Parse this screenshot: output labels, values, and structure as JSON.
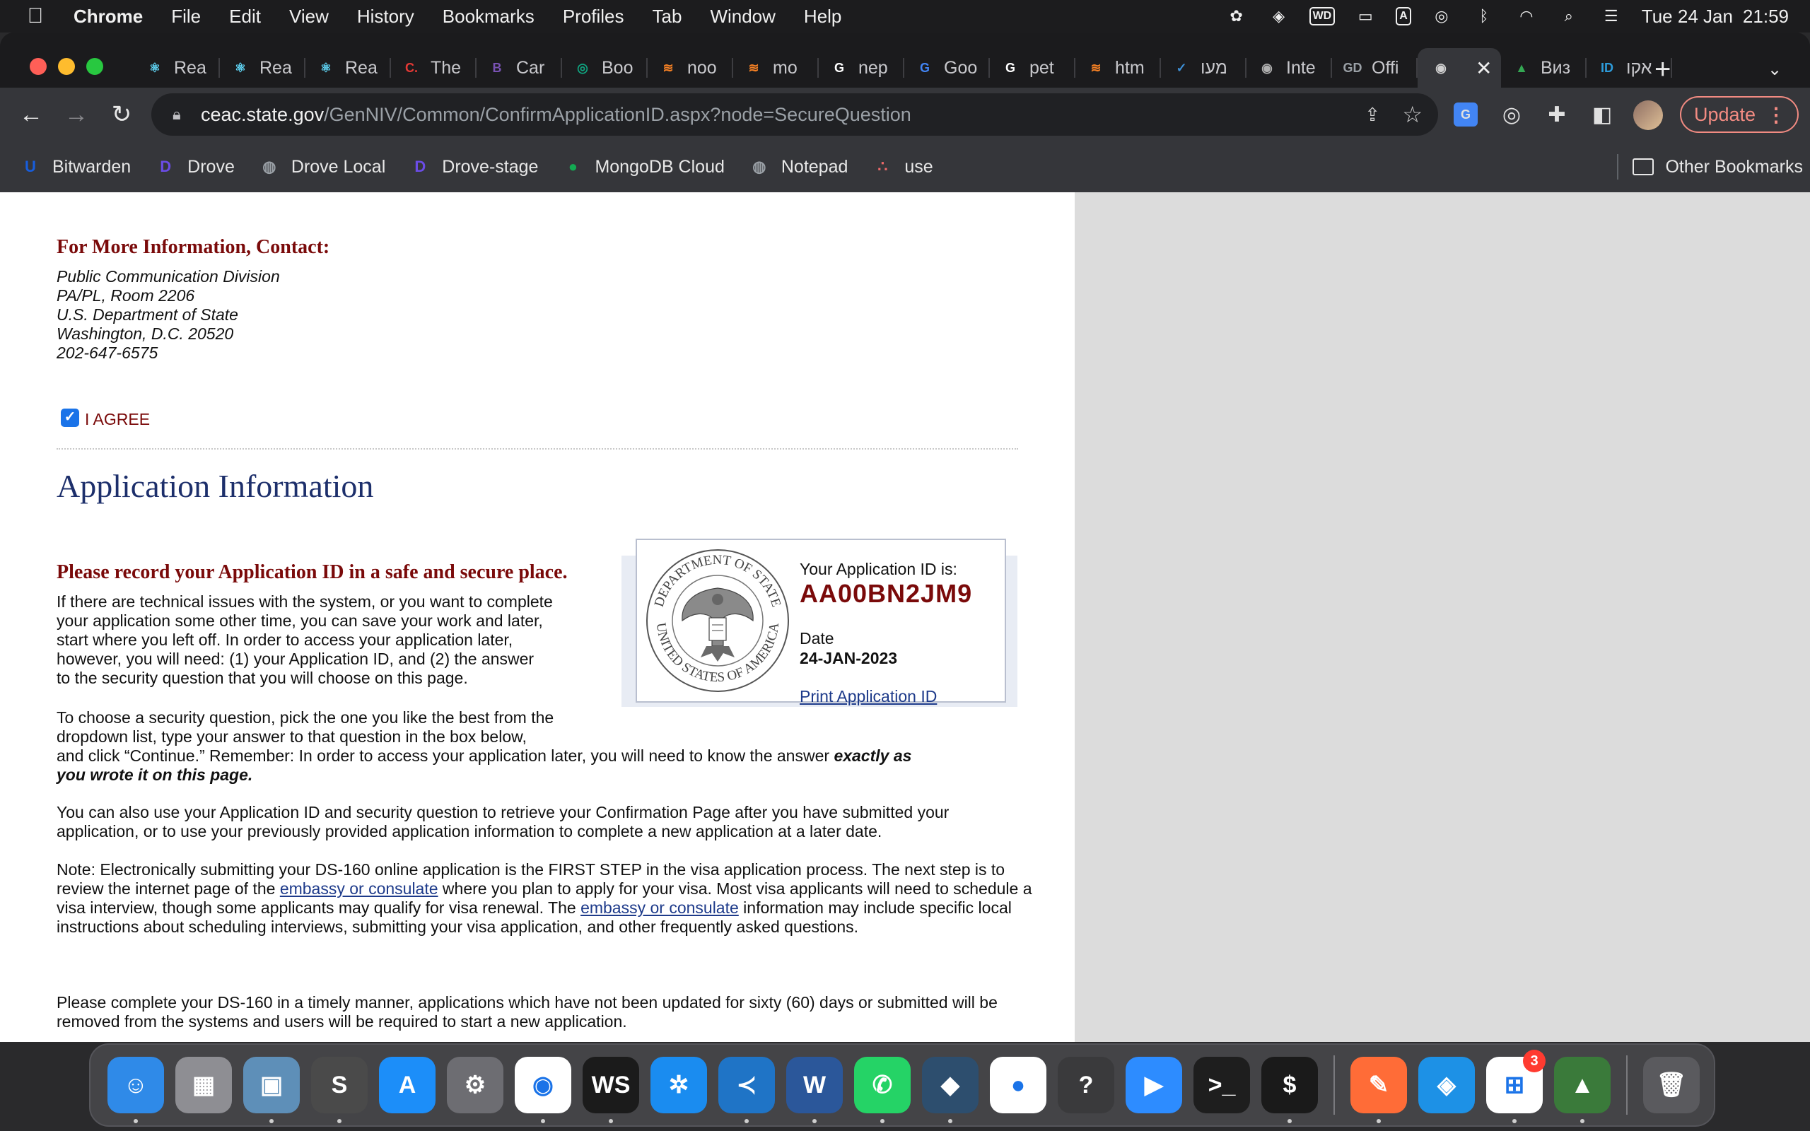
{
  "menubar": {
    "app_name": "Chrome",
    "items": [
      "File",
      "Edit",
      "View",
      "History",
      "Bookmarks",
      "Profiles",
      "Tab",
      "Window",
      "Help"
    ],
    "clock": {
      "date": "Tue 24 Jan",
      "time": "21:59"
    },
    "status_box_a": "A",
    "status_box_wd": "WD"
  },
  "tabs": [
    {
      "label": "Rea",
      "icon": "react-icon",
      "color": "#61dafb",
      "glyph": "⚛"
    },
    {
      "label": "Rea",
      "icon": "react-icon",
      "color": "#61dafb",
      "glyph": "⚛"
    },
    {
      "label": "Rea",
      "icon": "react-icon",
      "color": "#61dafb",
      "glyph": "⚛"
    },
    {
      "label": "The",
      "icon": "c-icon",
      "color": "#e53935",
      "glyph": "C."
    },
    {
      "label": "Car",
      "icon": "bootstrap-icon",
      "color": "#7952b3",
      "glyph": "B"
    },
    {
      "label": "Boo",
      "icon": "openai-icon",
      "color": "#10a37f",
      "glyph": "◎"
    },
    {
      "label": "noo",
      "icon": "stackoverflow-icon",
      "color": "#f48024",
      "glyph": "≋"
    },
    {
      "label": "mo",
      "icon": "stackoverflow-icon",
      "color": "#f48024",
      "glyph": "≋"
    },
    {
      "label": "nep",
      "icon": "google-icon",
      "color": "#ffffff",
      "glyph": "G"
    },
    {
      "label": "Goo",
      "icon": "google-translate-icon",
      "color": "#4285f4",
      "glyph": "G"
    },
    {
      "label": "pet",
      "icon": "google-icon",
      "color": "#ffffff",
      "glyph": "G"
    },
    {
      "label": "htm",
      "icon": "stackoverflow-icon",
      "color": "#f48024",
      "glyph": "≋"
    },
    {
      "label": "מעו",
      "icon": "check-icon",
      "color": "#3d8fd6",
      "glyph": "✓"
    },
    {
      "label": "Inte",
      "icon": "seal-icon",
      "color": "#b0b0b0",
      "glyph": "◉"
    },
    {
      "label": "Offi",
      "icon": "gd-icon",
      "color": "#9aa0a6",
      "glyph": "GD"
    },
    {
      "label": "",
      "icon": "seal-icon",
      "color": "#d0d0d0",
      "glyph": "◉",
      "active": true
    },
    {
      "label": "Виз",
      "icon": "google-drive-icon",
      "color": "#34a853",
      "glyph": "▲"
    },
    {
      "label": "אקו",
      "icon": "id-icon",
      "color": "#2d9cdb",
      "glyph": "ID"
    }
  ],
  "toolbar": {
    "url_domain": "ceac.state.gov",
    "url_path": "/GenNIV/Common/ConfirmApplicationID.aspx?node=SecureQuestion",
    "update_label": "Update"
  },
  "bookmarks": [
    {
      "label": "Bitwarden",
      "icon": "bitwarden-icon",
      "color": "#175ddc",
      "glyph": "U"
    },
    {
      "label": "Drove",
      "icon": "drove-icon",
      "color": "#6b4ce6",
      "glyph": "D"
    },
    {
      "label": "Drove Local",
      "icon": "globe-icon",
      "color": "#9aa0a6",
      "glyph": "◍"
    },
    {
      "label": "Drove-stage",
      "icon": "drove-icon",
      "color": "#6b4ce6",
      "glyph": "D"
    },
    {
      "label": "MongoDB Cloud",
      "icon": "mongodb-icon",
      "color": "#13aa52",
      "glyph": "●"
    },
    {
      "label": "Notepad",
      "icon": "globe-icon",
      "color": "#9aa0a6",
      "glyph": "◍"
    },
    {
      "label": "use",
      "icon": "asana-icon",
      "color": "#f06a6a",
      "glyph": "∴"
    }
  ],
  "other_bookmarks_label": "Other Bookmarks",
  "page": {
    "contact_heading": "For More Information, Contact:",
    "contact_lines": [
      "Public Communication Division",
      "PA/PL, Room 2206",
      "U.S. Department of State",
      "Washington, D.C. 20520",
      "202-647-6575"
    ],
    "agree_label": "I AGREE",
    "agree_checked": true,
    "section_title": "Application Information",
    "record_heading": "Please record your Application ID in a safe and secure place.",
    "intro_lines": [
      "If there are technical issues with the system, or you want to complete",
      "your application some other time, you can save your work and later,",
      "start where you left off. In order to access your application later,",
      "however, you will need: (1) your Application ID, and (2) the answer",
      "to the security question that you will choose on this page."
    ],
    "security_line1": "To choose a security question, pick the one you like the best from the",
    "security_line2": "dropdown list, type your answer to that question in the box below,",
    "security_line3": "and click “Continue.” Remember: In order to access your application later, you will need to know the answer ",
    "security_emph1": "exactly as",
    "security_emph2": "you wrote it on this page.",
    "retrieve_para": "You can also use your Application ID and security question to retrieve your Confirmation Page after you have submitted your application, or to use your previously provided application information to complete a new application at a later date.",
    "note_part1": "Note: Electronically submitting your DS-160 online application is the FIRST STEP in the visa application process. The next step is to review the internet page of the ",
    "note_link1": "embassy or consulate",
    "note_part2": " where you plan to apply for your visa. Most visa applicants will need to schedule a visa interview, though some applicants may qualify for visa renewal. The ",
    "note_link2": "embassy or consulate",
    "note_part3": " information may include specific local instructions about scheduling interviews, submitting your visa application, and other frequently asked questions.",
    "timely_para": "Please complete your DS-160 in a timely manner, applications which have not been updated for sixty (60) days or submitted will be removed from the systems and users will be required to start a new application.",
    "appid_label": "Your Application ID is:",
    "appid_value": "AA00BN2JM9",
    "date_label": "Date",
    "date_value": "24-JAN-2023",
    "print_link": "Print Application ID",
    "seal_top_text": "DEPARTMENT OF STATE",
    "seal_bottom_text": "UNITED STATES OF AMERICA"
  },
  "dock": [
    {
      "name": "finder",
      "color": "#2f8ae8",
      "glyph": "☺",
      "running": true
    },
    {
      "name": "launchpad",
      "color": "#8e8e93",
      "glyph": "▦",
      "running": false
    },
    {
      "name": "preview",
      "color": "#5e8fb8",
      "glyph": "▣",
      "running": true
    },
    {
      "name": "sublime-text",
      "color": "#4a4a4a",
      "glyph": "S",
      "running": true
    },
    {
      "name": "app-store",
      "color": "#1c8ef9",
      "glyph": "A",
      "running": false
    },
    {
      "name": "system-preferences",
      "color": "#6d6d72",
      "glyph": "⚙",
      "running": false
    },
    {
      "name": "chrome",
      "color": "#ffffff",
      "glyph": "◉",
      "running": true
    },
    {
      "name": "webstorm",
      "color": "#1b1b1b",
      "glyph": "WS",
      "running": true
    },
    {
      "name": "safari",
      "color": "#1a8cf0",
      "glyph": "✲",
      "running": false
    },
    {
      "name": "vscode",
      "color": "#1f74c6",
      "glyph": "≺",
      "running": true
    },
    {
      "name": "word",
      "color": "#2b579a",
      "glyph": "W",
      "running": true
    },
    {
      "name": "whatsapp",
      "color": "#25d366",
      "glyph": "✆",
      "running": true
    },
    {
      "name": "mysql-workbench",
      "color": "#2d4e6e",
      "glyph": "◆",
      "running": true
    },
    {
      "name": "mongodb-compass",
      "color": "#ffffff",
      "glyph": "●",
      "running": false
    },
    {
      "name": "help",
      "color": "#3a3a3c",
      "glyph": "?",
      "running": false
    },
    {
      "name": "zoom",
      "color": "#2d8cff",
      "glyph": "▶",
      "running": false
    },
    {
      "name": "terminal",
      "color": "#1e1e1e",
      "glyph": ">_",
      "running": false
    },
    {
      "name": "iterm",
      "color": "#1a1a1a",
      "glyph": "$",
      "running": true
    },
    {
      "name": "postman",
      "color": "#ff6c37",
      "glyph": "✎",
      "running": true
    },
    {
      "name": "docker",
      "color": "#1d91e6",
      "glyph": "◈",
      "running": false
    },
    {
      "name": "app-installer",
      "color": "#ffffff",
      "glyph": "⊞",
      "running": true,
      "badge": "3"
    },
    {
      "name": "rocket",
      "color": "#3a7a3a",
      "glyph": "▲",
      "running": true
    },
    {
      "name": "trash",
      "color": "#5a5a5e",
      "glyph": "🗑",
      "running": false
    }
  ]
}
